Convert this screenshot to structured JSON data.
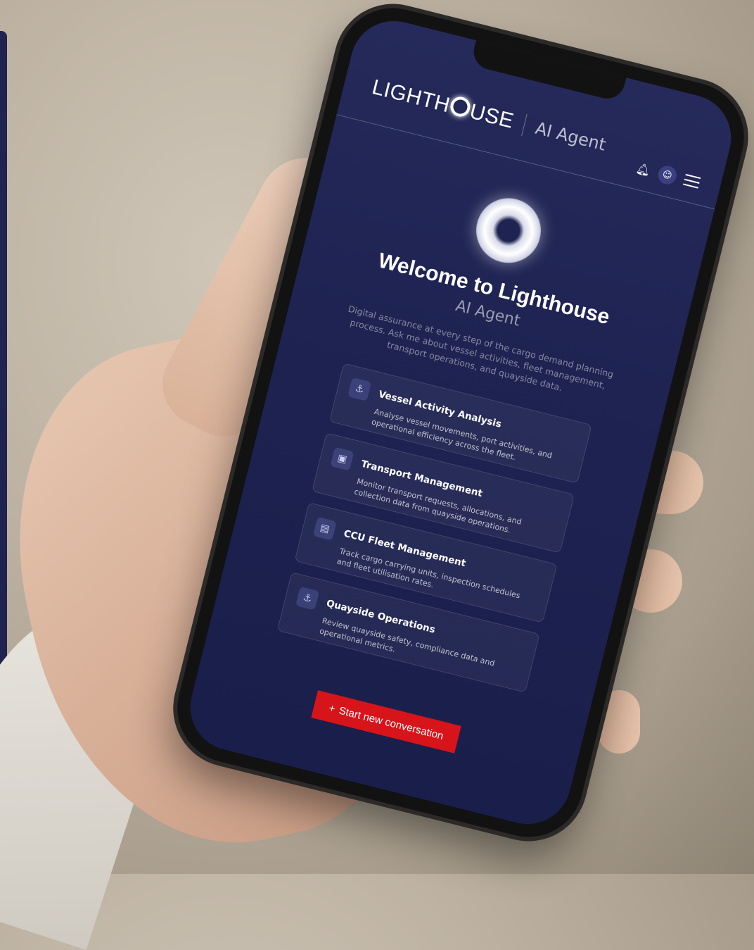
{
  "header": {
    "logo": {
      "before": "LIGHTH",
      "after": "USE"
    },
    "agent_label": "AI Agent"
  },
  "hero": {
    "welcome": "Welcome to Lighthouse",
    "subtitle": "AI Agent",
    "intro": "Digital assurance at every step of the cargo demand planning process. Ask me about vessel activities, fleet management, transport operations, and quayside data."
  },
  "cards": [
    {
      "icon": "ship-icon",
      "title": "Vessel Activity Analysis",
      "desc": "Analyse vessel movements, port activities, and operational efficiency across the fleet."
    },
    {
      "icon": "truck-icon",
      "title": "Transport Management",
      "desc": "Monitor transport requests, allocations, and collection data from quayside operations."
    },
    {
      "icon": "container-icon",
      "title": "CCU Fleet Management",
      "desc": "Track cargo carrying units, inspection schedules and fleet utilisation rates."
    },
    {
      "icon": "anchor-icon",
      "title": "Quayside Operations",
      "desc": "Review quayside safety, compliance data and operational metrics."
    }
  ],
  "cta": {
    "plus": "+",
    "label": "Start new conversation"
  },
  "colors": {
    "screen_bg": "#1e2352",
    "accent": "#d6141a",
    "panel": "#1f2350"
  }
}
